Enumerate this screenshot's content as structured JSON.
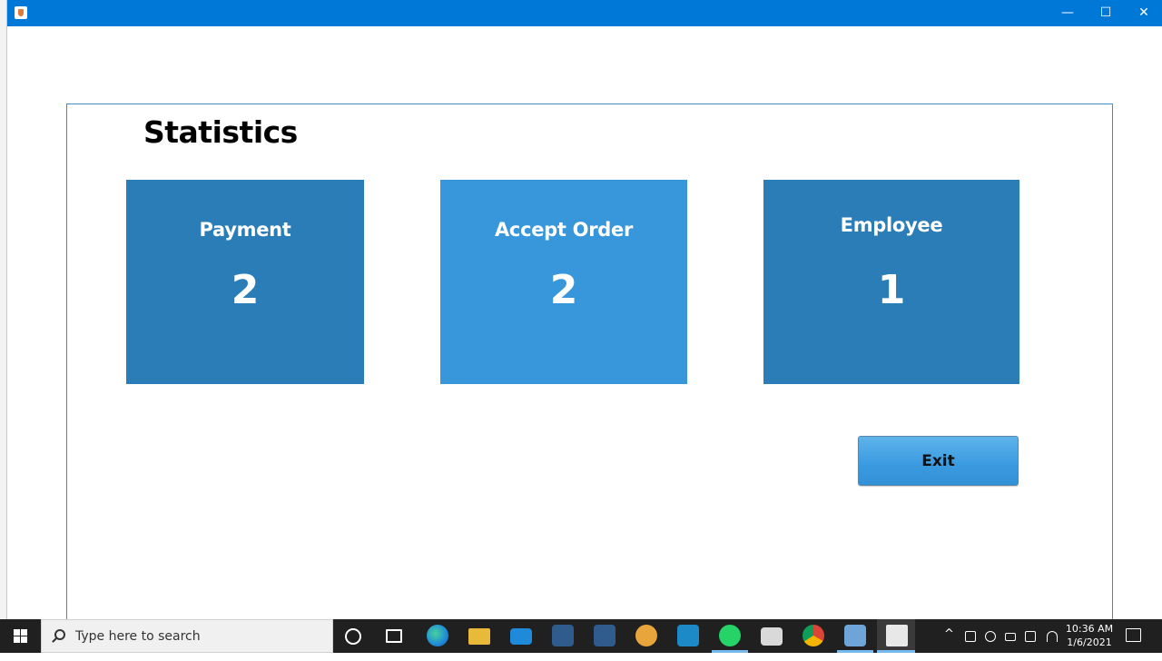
{
  "window": {
    "min_glyph": "—",
    "max_glyph": "☐",
    "close_glyph": "✕"
  },
  "page": {
    "title": "Statistics"
  },
  "cards": [
    {
      "label": "Payment",
      "value": "2",
      "color": "#2b7db8"
    },
    {
      "label": "Accept Order",
      "value": "2",
      "color": "#3797da"
    },
    {
      "label": "Employee",
      "value": "1",
      "color": "#2b7db8"
    }
  ],
  "actions": {
    "exit_label": "Exit"
  },
  "taskbar": {
    "search_placeholder": "Type here to search",
    "time": "10:36 AM",
    "date": "1/6/2021",
    "chevron_glyph": "^",
    "apps": [
      "cortana-icon",
      "task-view-icon",
      "edge-icon",
      "file-explorer-icon",
      "mail-icon",
      "visual-studio-icon",
      "visual-studio-icon",
      "java-duke-icon",
      "trello-icon",
      "whatsapp-icon",
      "store-icon",
      "chrome-icon",
      "virtualbox-icon",
      "java-app-icon"
    ]
  }
}
